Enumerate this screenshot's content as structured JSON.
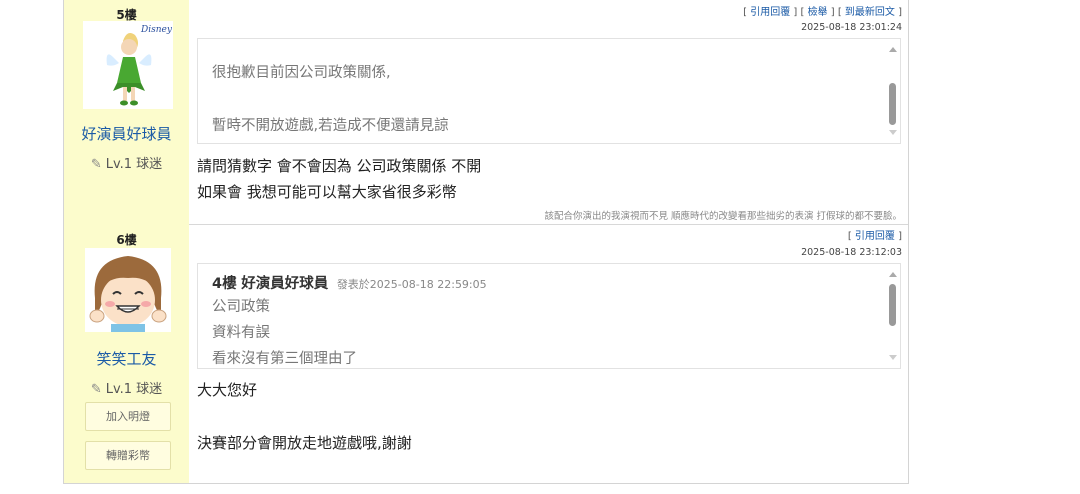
{
  "posts": [
    {
      "floor": "5樓",
      "username": "好演員好球員",
      "level": "Lv.1 球迷",
      "actions": {
        "quote_reply": "引用回覆",
        "report": "檢舉",
        "latest": "到最新回文"
      },
      "timestamp": "2025-08-18 23:01:24",
      "quote_lines": [
        "很抱歉目前因公司政策關係,",
        "暫時不開放遊戲,若造成不便還請見諒"
      ],
      "body_lines": [
        "請問猜數字 會不會因為 公司政策關係 不開",
        "如果會 我想可能可以幫大家省很多彩幣"
      ],
      "signature": "該配合你演出的我演視而不見 順應時代的改變看那些拙劣的表演 打假球的都不要臉。",
      "avatar_icon": "fairy-figurine-avatar",
      "avatar_brand": "Disney"
    },
    {
      "floor": "6樓",
      "username": "笑笑工友",
      "level": "Lv.1 球迷",
      "actions": {
        "quote_reply": "引用回覆"
      },
      "timestamp": "2025-08-18 23:12:03",
      "quote_header": {
        "floor": "4樓",
        "author": "好演員好球員",
        "posted_at": "發表於2025-08-18 22:59:05"
      },
      "quote_lines": [
        "公司政策",
        "資料有誤",
        "看來沒有第三個理由了"
      ],
      "body_lines": [
        "大大您好",
        "決賽部分會開放走地遊戲哦,謝謝"
      ],
      "buttons": {
        "add_light": "加入明燈",
        "gift_coins": "轉贈彩幣"
      },
      "avatar_icon": "smiling-girl-avatar"
    }
  ],
  "colors": {
    "sidebar_bg": "#fcfccc",
    "link": "#1a5aa6"
  }
}
